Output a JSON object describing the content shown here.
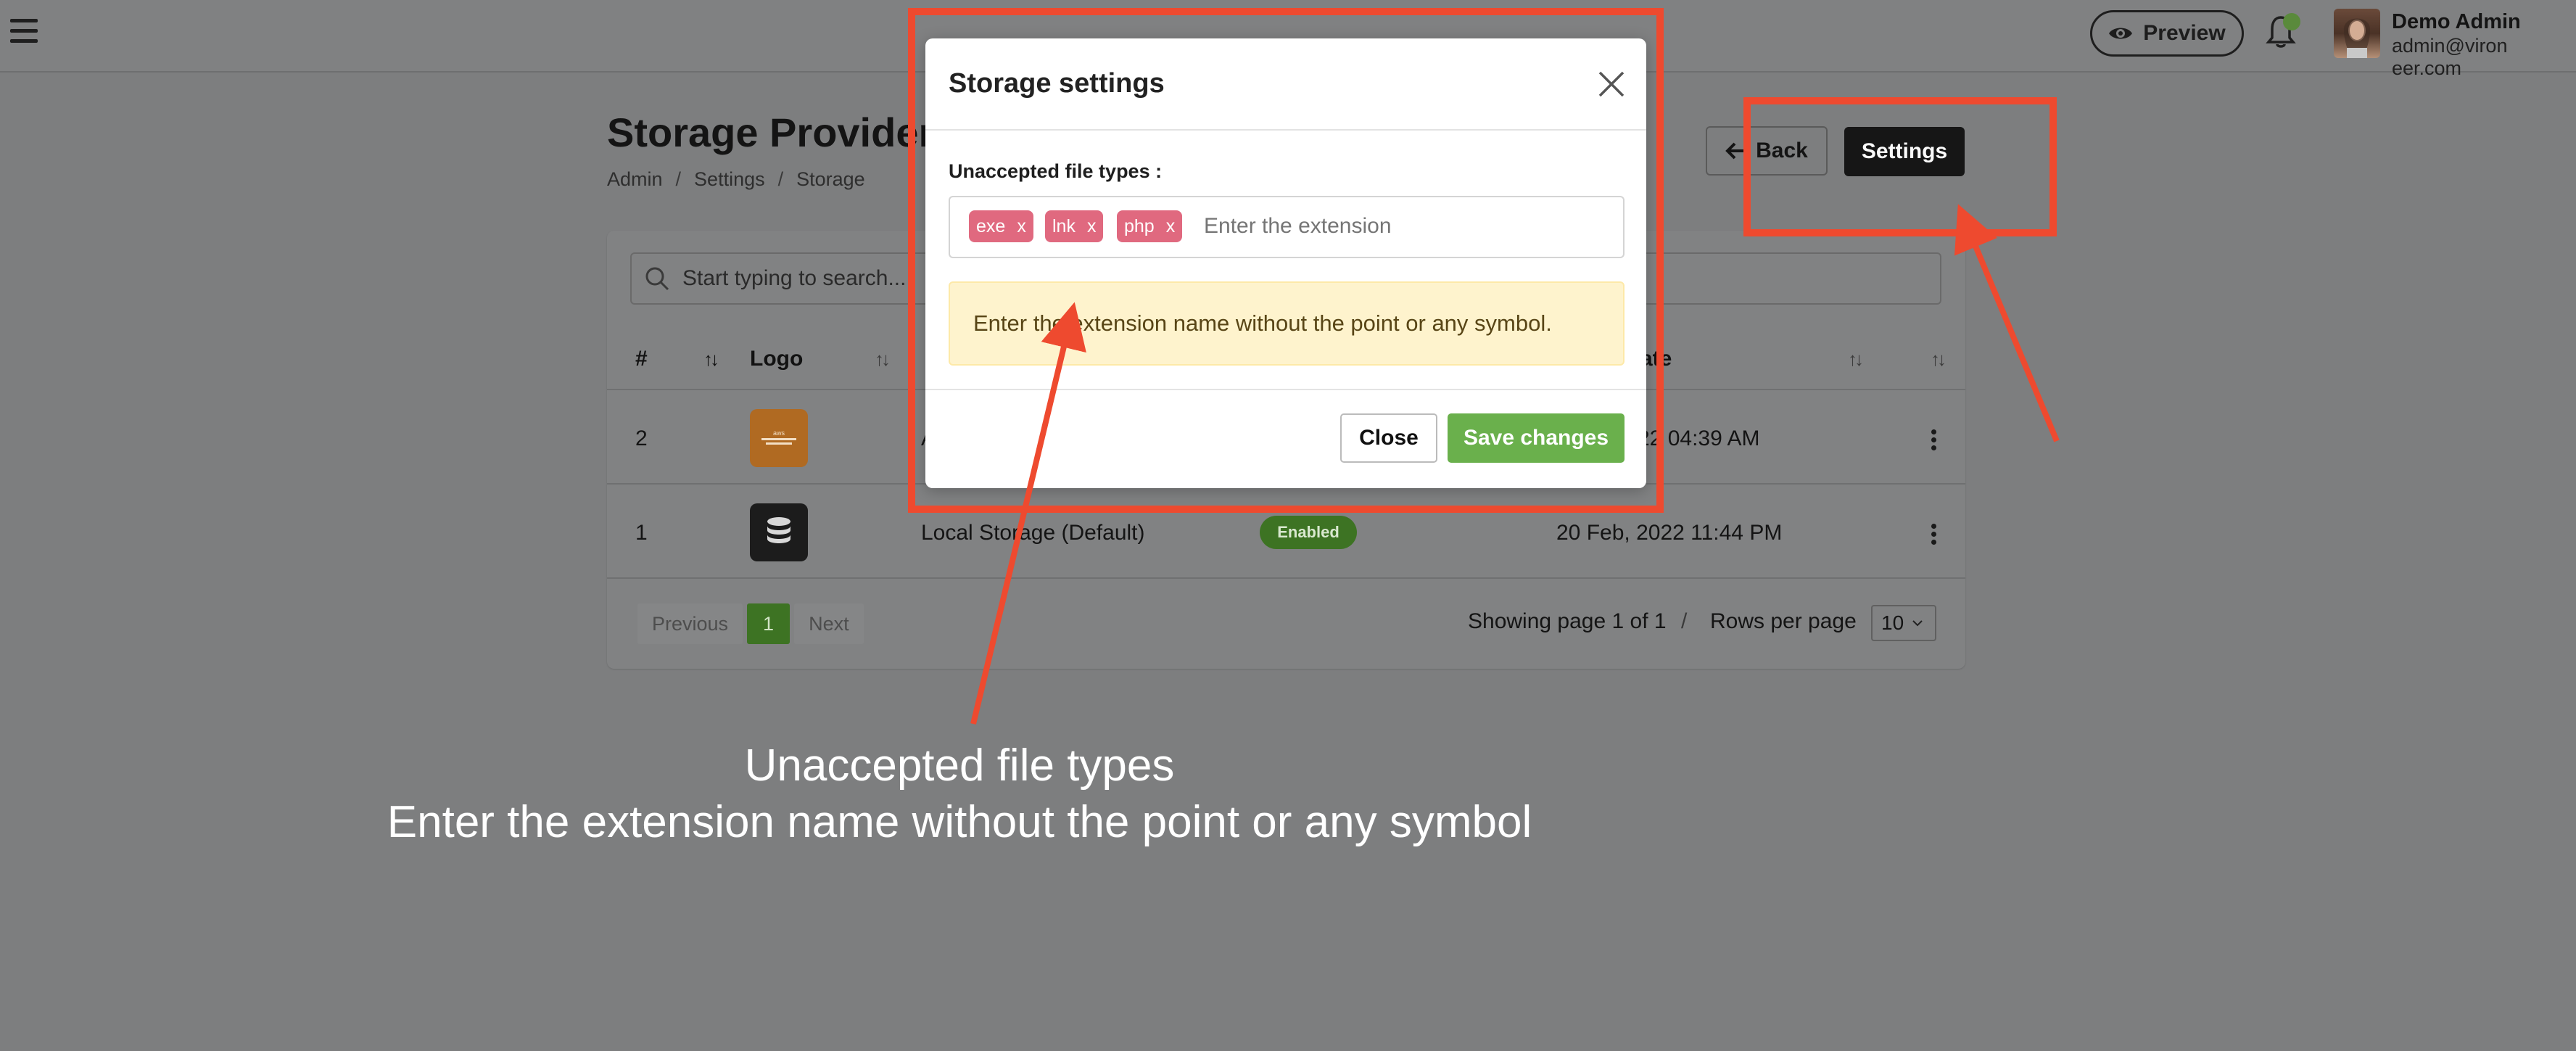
{
  "topbar": {
    "preview_label": "Preview",
    "user_name": "Demo Admin",
    "user_email": "admin@viron​eer.com"
  },
  "page": {
    "title": "Storage Providers",
    "breadcrumb": [
      "Admin",
      "Settings",
      "Storage"
    ],
    "back_label": "Back",
    "settings_label": "Settings"
  },
  "table": {
    "search_placeholder": "Start typing to search...",
    "headers": {
      "number": "#",
      "logo": "Logo",
      "name": "",
      "status": "",
      "date": "ate"
    },
    "rows": [
      {
        "id": "2",
        "name": "A",
        "status": "",
        "date": "22 04:39 AM"
      },
      {
        "id": "1",
        "name": "Local Storage (Default)",
        "status": "Enabled",
        "date": "20 Feb, 2022 11:44 PM"
      }
    ]
  },
  "pagination": {
    "previous": "Previous",
    "current": "1",
    "next": "Next",
    "page_info": "Showing page 1 of 1",
    "separator": "/",
    "rows_label": "Rows per page",
    "rows_value": "10"
  },
  "modal": {
    "title": "Storage settings",
    "field_label": "Unaccepted file types :",
    "tags": [
      "exe",
      "lnk",
      "php"
    ],
    "tag_remove": "x",
    "input_placeholder": "Enter the extension",
    "alert_text": "Enter the extension name without the point or any symbol.",
    "close_label": "Close",
    "save_label": "Save changes"
  },
  "annotation": {
    "line1": "Unaccepted file types",
    "line2": "Enter the extension name without the point or any symbol",
    "color": "#ee4a2f"
  }
}
